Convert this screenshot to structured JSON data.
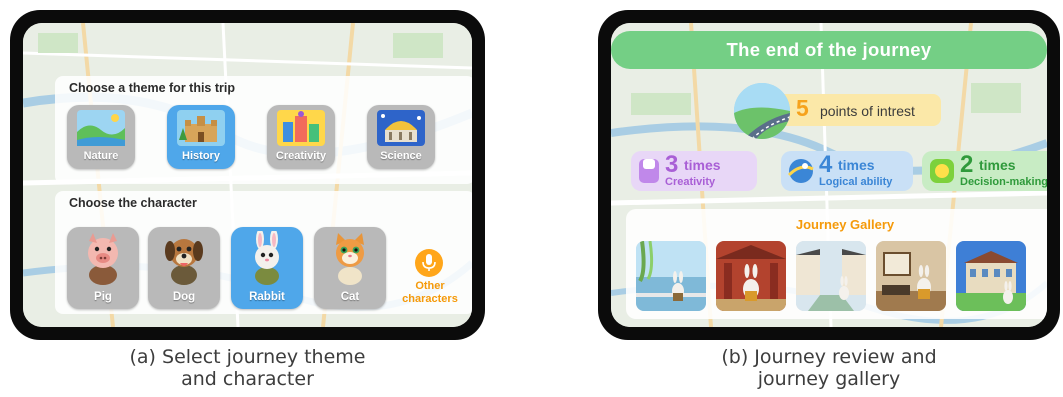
{
  "screen_a": {
    "theme_section": {
      "title": "Choose a theme for this trip",
      "themes": [
        {
          "label": "Nature",
          "selected": false
        },
        {
          "label": "History",
          "selected": true
        },
        {
          "label": "Creativity",
          "selected": false
        },
        {
          "label": "Science",
          "selected": false
        }
      ]
    },
    "character_section": {
      "title": "Choose the character",
      "characters": [
        {
          "label": "Pig",
          "selected": false
        },
        {
          "label": "Dog",
          "selected": false
        },
        {
          "label": "Rabbit",
          "selected": true
        },
        {
          "label": "Cat",
          "selected": false
        }
      ],
      "other_label_line1": "Other",
      "other_label_line2": "characters"
    },
    "caption_line1": "(a) Select journey theme",
    "caption_line2": "and character"
  },
  "screen_b": {
    "title": "The end of the journey",
    "poi": {
      "number": "5",
      "text": "points of intrest"
    },
    "stats": [
      {
        "number": "3",
        "unit": "times",
        "label": "Creativity",
        "color": "#a95fd6"
      },
      {
        "number": "4",
        "unit": "times",
        "label": "Logical ability",
        "color": "#3b86d6"
      },
      {
        "number": "2",
        "unit": "times",
        "label": "Decision-making",
        "color": "#2f9a3b"
      }
    ],
    "gallery_title": "Journey Gallery",
    "caption_line1": "(b) Journey review and",
    "caption_line2": "journey gallery"
  },
  "colors": {
    "selected_card": "#4fa7ea",
    "unselected_card": "#b9b9b9",
    "title_banner": "#74cf85",
    "accent_orange": "#f59a0a"
  },
  "icons": {
    "theme_images": [
      "landscape-icon",
      "castle-icon",
      "art-building-icon",
      "science-building-icon"
    ],
    "characters": [
      "pig-icon",
      "dog-icon",
      "rabbit-icon",
      "cat-icon"
    ],
    "microphone": "microphone-icon"
  }
}
